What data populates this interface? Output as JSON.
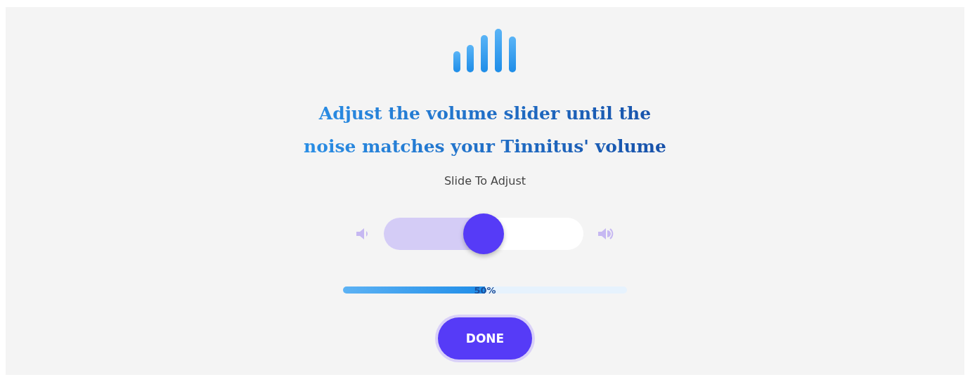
{
  "heading": "Adjust the volume slider until the noise matches your Tinnitus' volume",
  "instruction": "Slide To Adjust",
  "volume_slider": {
    "level": 0.5
  },
  "progress": {
    "level": 0.5,
    "reading": "50%"
  },
  "buttons": [
    "DONE"
  ]
}
